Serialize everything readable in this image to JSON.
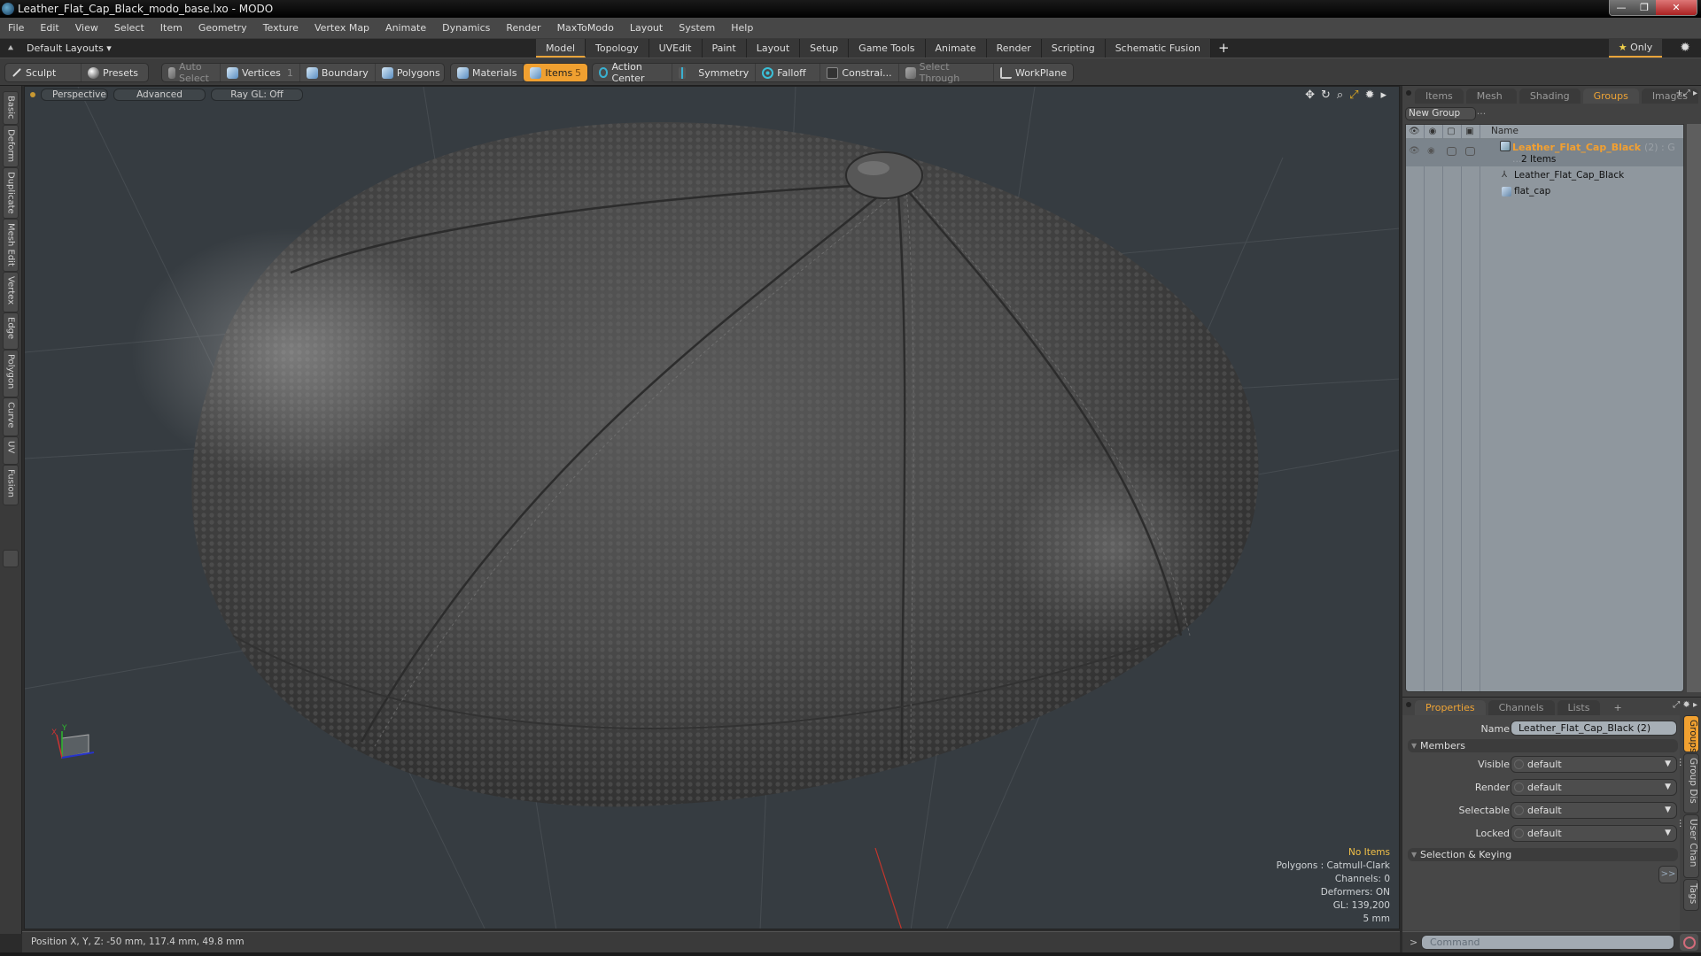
{
  "window": {
    "title": "Leather_Flat_Cap_Black_modo_base.lxo - MODO",
    "controls": [
      "minimize-icon",
      "restore-icon",
      "close-icon"
    ]
  },
  "menu": [
    "File",
    "Edit",
    "View",
    "Select",
    "Item",
    "Geometry",
    "Texture",
    "Vertex Map",
    "Animate",
    "Dynamics",
    "Render",
    "MaxToModo",
    "Layout",
    "System",
    "Help"
  ],
  "layoutbar": {
    "layout_selector": "Default Layouts ▾",
    "tabs": [
      "Model",
      "Topology",
      "UVEdit",
      "Paint",
      "Layout",
      "Setup",
      "Game Tools",
      "Animate",
      "Render",
      "Scripting",
      "Schematic Fusion"
    ],
    "active_tab": "Model",
    "add_tab": "+",
    "only_label": "Only",
    "only_icon": "star-icon"
  },
  "toolbar": {
    "group1": [
      {
        "label": "Sculpt",
        "icon": "brush-icon"
      },
      {
        "label": "Presets",
        "icon": "sphere-icon"
      }
    ],
    "group2": [
      {
        "label": "Auto Select",
        "icon": "cube-icon",
        "state": "disabled"
      },
      {
        "label": "Vertices",
        "icon": "cube-vertex-icon",
        "badge": "1"
      },
      {
        "label": "Boundary",
        "icon": "cube-edge-icon"
      },
      {
        "label": "Polygons",
        "icon": "cube-polygon-icon"
      }
    ],
    "group3": [
      {
        "label": "Materials",
        "icon": "cube-material-icon"
      },
      {
        "label": "Items",
        "icon": "cube-item-icon",
        "badge": "5",
        "state": "active"
      }
    ],
    "group4": [
      {
        "label": "Action Center",
        "icon": "crosshair-icon"
      },
      {
        "label": "Symmetry",
        "icon": "symmetry-icon"
      },
      {
        "label": "Falloff",
        "icon": "falloff-icon"
      },
      {
        "label": "Constrai...",
        "icon": "constraint-icon"
      },
      {
        "label": "Select Through",
        "icon": "select-through-icon",
        "state": "disabled"
      },
      {
        "label": "WorkPlane",
        "icon": "workplane-icon"
      }
    ]
  },
  "left_tabs": [
    "Basic",
    "Deform",
    "Duplicate",
    "Mesh Edit",
    "Vertex",
    "Edge",
    "Polygon",
    "Curve",
    "UV",
    "Fusion"
  ],
  "viewport": {
    "view_mode": "Perspective",
    "shading": "Advanced",
    "raygl": "Ray GL: Off",
    "info": {
      "items": "No Items",
      "polygons": "Polygons : Catmull-Clark",
      "channels": "Channels: 0",
      "deformers": "Deformers: ON",
      "gl": "GL: 139,200",
      "grid": "5 mm"
    },
    "axis_labels": {
      "x": "X",
      "y": "Y"
    }
  },
  "statusbar": {
    "position": "Position X, Y, Z:   -50 mm, 117.4 mm, 49.8 mm"
  },
  "items_panel": {
    "tabs": [
      "Items",
      "Mesh ...",
      "Shading",
      "Groups",
      "Images"
    ],
    "active_tab": "Groups",
    "new_group": "New Group",
    "column_name": "Name",
    "group": {
      "name": "Leather_Flat_Cap_Black",
      "count": "(2) : G ...",
      "subtitle": "2 Items",
      "children": [
        {
          "name": "Leather_Flat_Cap_Black",
          "icon": "locator-icon"
        },
        {
          "name": "flat_cap",
          "icon": "mesh-icon"
        }
      ]
    }
  },
  "properties_panel": {
    "tabs": [
      "Properties",
      "Channels",
      "Lists"
    ],
    "active_tab": "Properties",
    "add_tab": "+",
    "name_label": "Name",
    "name_value": "Leather_Flat_Cap_Black (2)",
    "members_section": "Members",
    "fields": [
      {
        "label": "Visible",
        "value": "default"
      },
      {
        "label": "Render",
        "value": "default"
      },
      {
        "label": "Selectable",
        "value": "default"
      },
      {
        "label": "Locked",
        "value": "default"
      }
    ],
    "selection_section": "Selection & Keying",
    "expand_button": ">>",
    "side_tabs": [
      "Groups",
      "Group Dis ...",
      "User Chan ...",
      "Tags"
    ],
    "active_side_tab": "Groups"
  },
  "command": {
    "prompt": ">",
    "placeholder": "Command"
  },
  "colors": {
    "accent": "#f0a030",
    "viewport_bg": "#363c41",
    "panel_bg": "#424242",
    "tree_bg": "#8f979e",
    "group_name": "#f2a031"
  }
}
